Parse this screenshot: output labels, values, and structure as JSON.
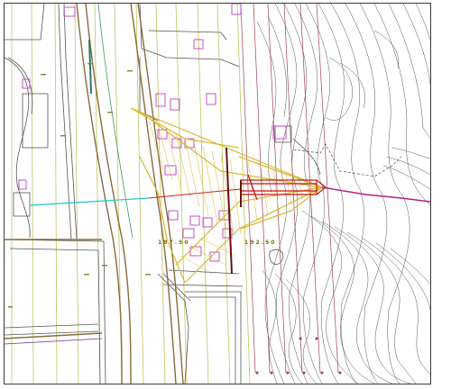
{
  "map": {
    "labels": {
      "station_left": "1 8 7 . 5 0",
      "station_right": "1 9 2 . 5 0"
    },
    "colors": {
      "contour": "#444444",
      "grid_vertical": "#b8bc4a",
      "section_lines": "#a04050",
      "building": "#c040c0",
      "outline": "#555555",
      "slope": "#d8b830",
      "axis_cyan": "#20c8c8",
      "axis_red": "#cc2020",
      "axis_magenta": "#b02090",
      "road_brown": "#8a6a3a",
      "green_band": "#3a9a60"
    },
    "icons": [
      "north-arrow-icon"
    ]
  }
}
